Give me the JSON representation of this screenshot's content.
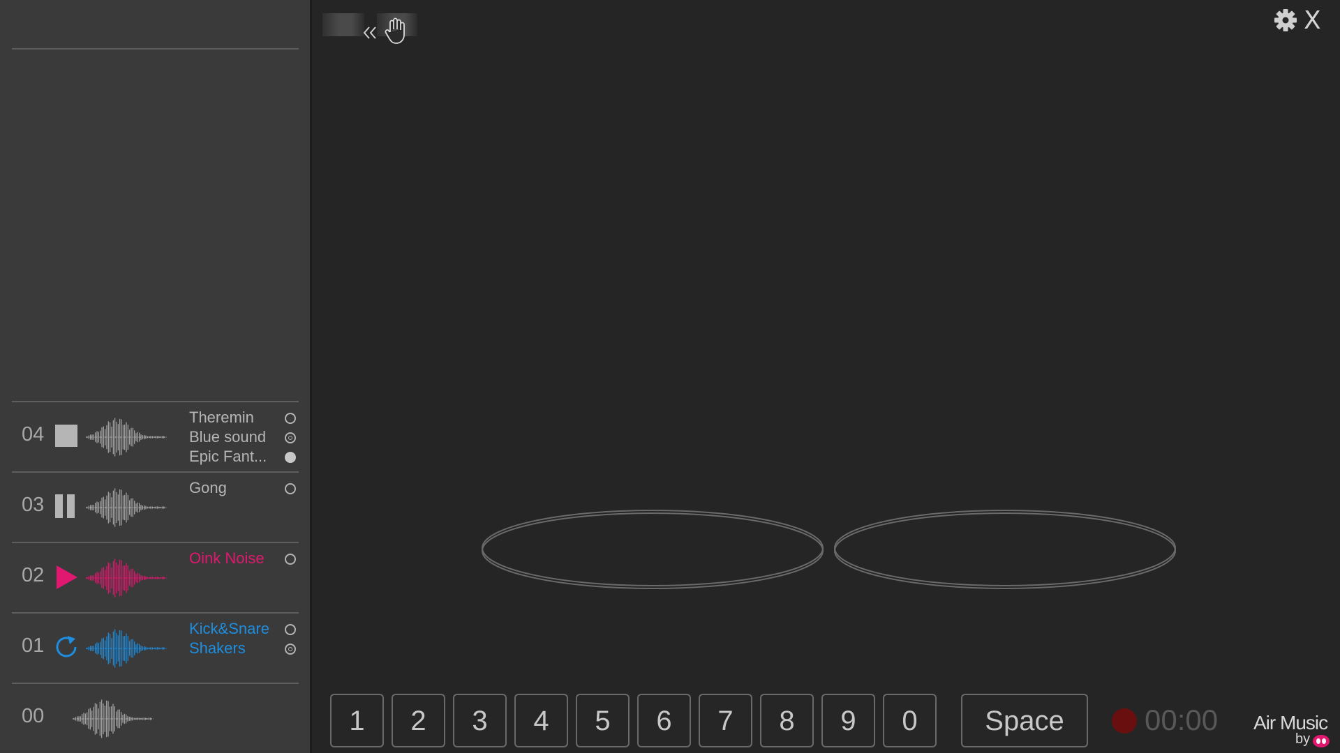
{
  "app": {
    "brand": "Air Music",
    "brand_by": "by"
  },
  "toolbar": {
    "collapse_icon": "double-chevron-left-icon",
    "hand_icon": "hand-icon",
    "settings_icon": "gear-icon",
    "close_label": "X"
  },
  "tracks": [
    {
      "number": "04",
      "control": "stop",
      "color": "#b5b5b5",
      "sounds": [
        {
          "name": "Theremin",
          "state": "empty"
        },
        {
          "name": "Blue sound",
          "state": "target"
        },
        {
          "name": "Epic Fant...",
          "state": "filled"
        }
      ]
    },
    {
      "number": "03",
      "control": "pause",
      "color": "#b5b5b5",
      "sounds": [
        {
          "name": "Gong",
          "state": "empty"
        }
      ]
    },
    {
      "number": "02",
      "control": "play",
      "color": "#e0186f",
      "sounds": [
        {
          "name": "Oink Noise",
          "state": "empty"
        }
      ]
    },
    {
      "number": "01",
      "control": "loop",
      "color": "#1e8ee0",
      "sounds": [
        {
          "name": "Kick&Snare",
          "state": "empty"
        },
        {
          "name": "Shakers",
          "state": "target"
        }
      ]
    },
    {
      "number": "00",
      "control": "none",
      "color": "#b5b5b5",
      "sounds": []
    }
  ],
  "keys": [
    "1",
    "2",
    "3",
    "4",
    "5",
    "6",
    "7",
    "8",
    "9",
    "0"
  ],
  "space_key": "Space",
  "recorder": {
    "time": "00:00",
    "dot_color": "#6a0f0f"
  },
  "colors": {
    "accent_pink": "#e0186f",
    "accent_blue": "#1e8ee0",
    "background": "#252525",
    "sidebar": "#3a3a3a"
  }
}
